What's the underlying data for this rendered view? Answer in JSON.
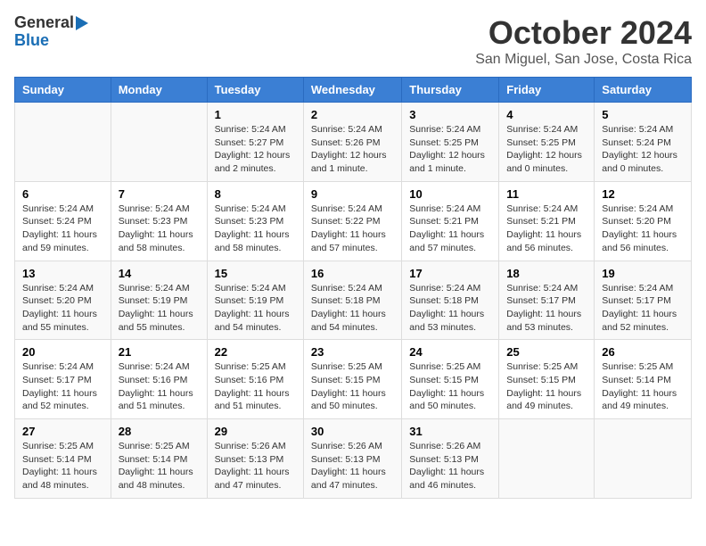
{
  "header": {
    "logo_general": "General",
    "logo_blue": "Blue",
    "title": "October 2024",
    "subtitle": "San Miguel, San Jose, Costa Rica"
  },
  "calendar": {
    "days_of_week": [
      "Sunday",
      "Monday",
      "Tuesday",
      "Wednesday",
      "Thursday",
      "Friday",
      "Saturday"
    ],
    "weeks": [
      [
        {
          "num": "",
          "info": ""
        },
        {
          "num": "",
          "info": ""
        },
        {
          "num": "1",
          "info": "Sunrise: 5:24 AM\nSunset: 5:27 PM\nDaylight: 12 hours\nand 2 minutes."
        },
        {
          "num": "2",
          "info": "Sunrise: 5:24 AM\nSunset: 5:26 PM\nDaylight: 12 hours\nand 1 minute."
        },
        {
          "num": "3",
          "info": "Sunrise: 5:24 AM\nSunset: 5:25 PM\nDaylight: 12 hours\nand 1 minute."
        },
        {
          "num": "4",
          "info": "Sunrise: 5:24 AM\nSunset: 5:25 PM\nDaylight: 12 hours\nand 0 minutes."
        },
        {
          "num": "5",
          "info": "Sunrise: 5:24 AM\nSunset: 5:24 PM\nDaylight: 12 hours\nand 0 minutes."
        }
      ],
      [
        {
          "num": "6",
          "info": "Sunrise: 5:24 AM\nSunset: 5:24 PM\nDaylight: 11 hours\nand 59 minutes."
        },
        {
          "num": "7",
          "info": "Sunrise: 5:24 AM\nSunset: 5:23 PM\nDaylight: 11 hours\nand 58 minutes."
        },
        {
          "num": "8",
          "info": "Sunrise: 5:24 AM\nSunset: 5:23 PM\nDaylight: 11 hours\nand 58 minutes."
        },
        {
          "num": "9",
          "info": "Sunrise: 5:24 AM\nSunset: 5:22 PM\nDaylight: 11 hours\nand 57 minutes."
        },
        {
          "num": "10",
          "info": "Sunrise: 5:24 AM\nSunset: 5:21 PM\nDaylight: 11 hours\nand 57 minutes."
        },
        {
          "num": "11",
          "info": "Sunrise: 5:24 AM\nSunset: 5:21 PM\nDaylight: 11 hours\nand 56 minutes."
        },
        {
          "num": "12",
          "info": "Sunrise: 5:24 AM\nSunset: 5:20 PM\nDaylight: 11 hours\nand 56 minutes."
        }
      ],
      [
        {
          "num": "13",
          "info": "Sunrise: 5:24 AM\nSunset: 5:20 PM\nDaylight: 11 hours\nand 55 minutes."
        },
        {
          "num": "14",
          "info": "Sunrise: 5:24 AM\nSunset: 5:19 PM\nDaylight: 11 hours\nand 55 minutes."
        },
        {
          "num": "15",
          "info": "Sunrise: 5:24 AM\nSunset: 5:19 PM\nDaylight: 11 hours\nand 54 minutes."
        },
        {
          "num": "16",
          "info": "Sunrise: 5:24 AM\nSunset: 5:18 PM\nDaylight: 11 hours\nand 54 minutes."
        },
        {
          "num": "17",
          "info": "Sunrise: 5:24 AM\nSunset: 5:18 PM\nDaylight: 11 hours\nand 53 minutes."
        },
        {
          "num": "18",
          "info": "Sunrise: 5:24 AM\nSunset: 5:17 PM\nDaylight: 11 hours\nand 53 minutes."
        },
        {
          "num": "19",
          "info": "Sunrise: 5:24 AM\nSunset: 5:17 PM\nDaylight: 11 hours\nand 52 minutes."
        }
      ],
      [
        {
          "num": "20",
          "info": "Sunrise: 5:24 AM\nSunset: 5:17 PM\nDaylight: 11 hours\nand 52 minutes."
        },
        {
          "num": "21",
          "info": "Sunrise: 5:24 AM\nSunset: 5:16 PM\nDaylight: 11 hours\nand 51 minutes."
        },
        {
          "num": "22",
          "info": "Sunrise: 5:25 AM\nSunset: 5:16 PM\nDaylight: 11 hours\nand 51 minutes."
        },
        {
          "num": "23",
          "info": "Sunrise: 5:25 AM\nSunset: 5:15 PM\nDaylight: 11 hours\nand 50 minutes."
        },
        {
          "num": "24",
          "info": "Sunrise: 5:25 AM\nSunset: 5:15 PM\nDaylight: 11 hours\nand 50 minutes."
        },
        {
          "num": "25",
          "info": "Sunrise: 5:25 AM\nSunset: 5:15 PM\nDaylight: 11 hours\nand 49 minutes."
        },
        {
          "num": "26",
          "info": "Sunrise: 5:25 AM\nSunset: 5:14 PM\nDaylight: 11 hours\nand 49 minutes."
        }
      ],
      [
        {
          "num": "27",
          "info": "Sunrise: 5:25 AM\nSunset: 5:14 PM\nDaylight: 11 hours\nand 48 minutes."
        },
        {
          "num": "28",
          "info": "Sunrise: 5:25 AM\nSunset: 5:14 PM\nDaylight: 11 hours\nand 48 minutes."
        },
        {
          "num": "29",
          "info": "Sunrise: 5:26 AM\nSunset: 5:13 PM\nDaylight: 11 hours\nand 47 minutes."
        },
        {
          "num": "30",
          "info": "Sunrise: 5:26 AM\nSunset: 5:13 PM\nDaylight: 11 hours\nand 47 minutes."
        },
        {
          "num": "31",
          "info": "Sunrise: 5:26 AM\nSunset: 5:13 PM\nDaylight: 11 hours\nand 46 minutes."
        },
        {
          "num": "",
          "info": ""
        },
        {
          "num": "",
          "info": ""
        }
      ]
    ]
  }
}
